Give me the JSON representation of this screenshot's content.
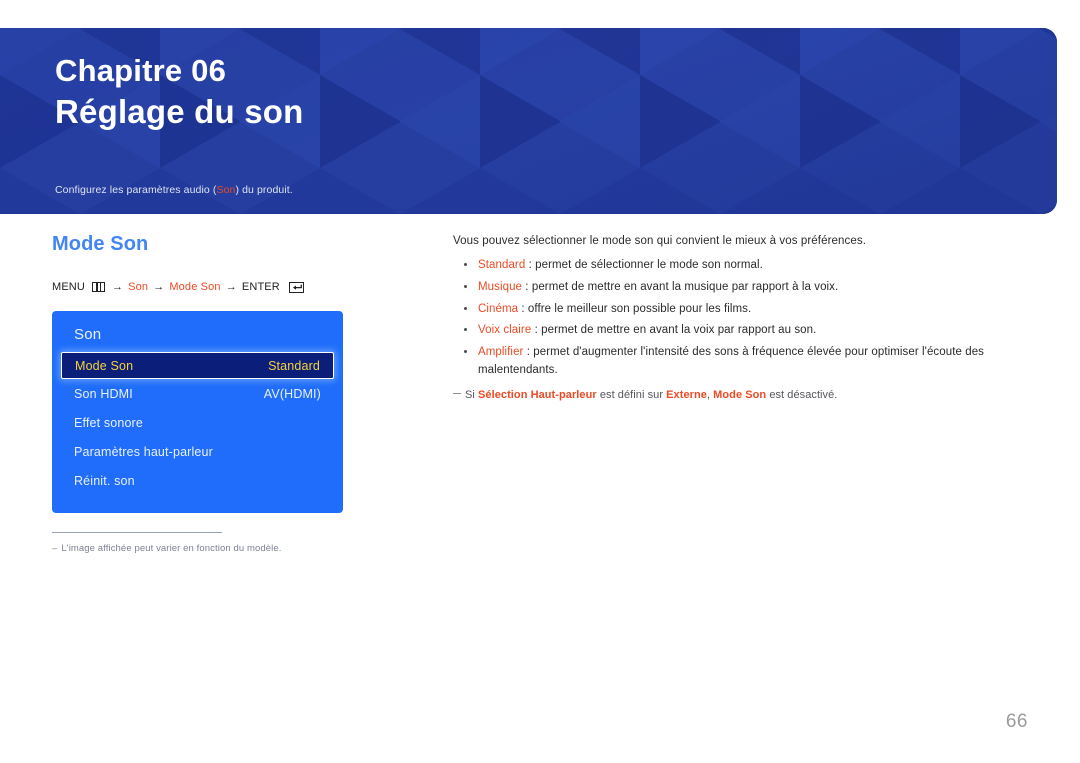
{
  "hero": {
    "chapter": "Chapitre 06",
    "title": "Réglage du son",
    "subtitle_before": "Configurez les paramètres audio (",
    "subtitle_highlight": "Son",
    "subtitle_after": ") du produit.",
    "bg_color": "#22399c",
    "highlight_color": "#ec4a24"
  },
  "left": {
    "section_title": "Mode Son",
    "menu_path": {
      "menu_label": "MENU",
      "menu_icon": "menu-grid-icon",
      "arrow": "→",
      "step1": "Son",
      "step2": "Mode Son",
      "enter_label": "ENTER",
      "enter_icon": "enter-key-icon"
    },
    "osd": {
      "title": "Son",
      "accent_color": "#1f6dfa",
      "selected_color": "#f5d23c",
      "rows": [
        {
          "label": "Mode Son",
          "value": "Standard",
          "selected": true
        },
        {
          "label": "Son HDMI",
          "value": "AV(HDMI)",
          "selected": false
        },
        {
          "label": "Effet sonore",
          "value": "",
          "selected": false
        },
        {
          "label": "Paramètres haut-parleur",
          "value": "",
          "selected": false
        },
        {
          "label": "Réinit. son",
          "value": "",
          "selected": false
        }
      ]
    },
    "footnote": {
      "dash": "–",
      "text": "L'image affichée peut varier en fonction du modèle."
    }
  },
  "right": {
    "lead": "Vous pouvez sélectionner le mode son qui convient le mieux à vos préférences.",
    "bullets": [
      {
        "term": "Standard",
        "rest": " : permet de sélectionner le mode son normal."
      },
      {
        "term": "Musique",
        "rest": " : permet de mettre en avant la musique par rapport à la voix."
      },
      {
        "term": "Cinéma",
        "rest": " : offre le meilleur son possible pour les films."
      },
      {
        "term": "Voix claire",
        "rest": " : permet de mettre en avant la voix par rapport au son."
      },
      {
        "term": "Amplifier",
        "rest": " : permet d'augmenter l'intensité des sons à fréquence élevée pour optimiser l'écoute des malentendants."
      }
    ],
    "note": {
      "p1": "Si ",
      "k1": "Sélection Haut-parleur",
      "p2": " est défini sur ",
      "k2": "Externe",
      "p3": ", ",
      "k3": "Mode Son",
      "p4": " est désactivé."
    }
  },
  "page_number": "66"
}
